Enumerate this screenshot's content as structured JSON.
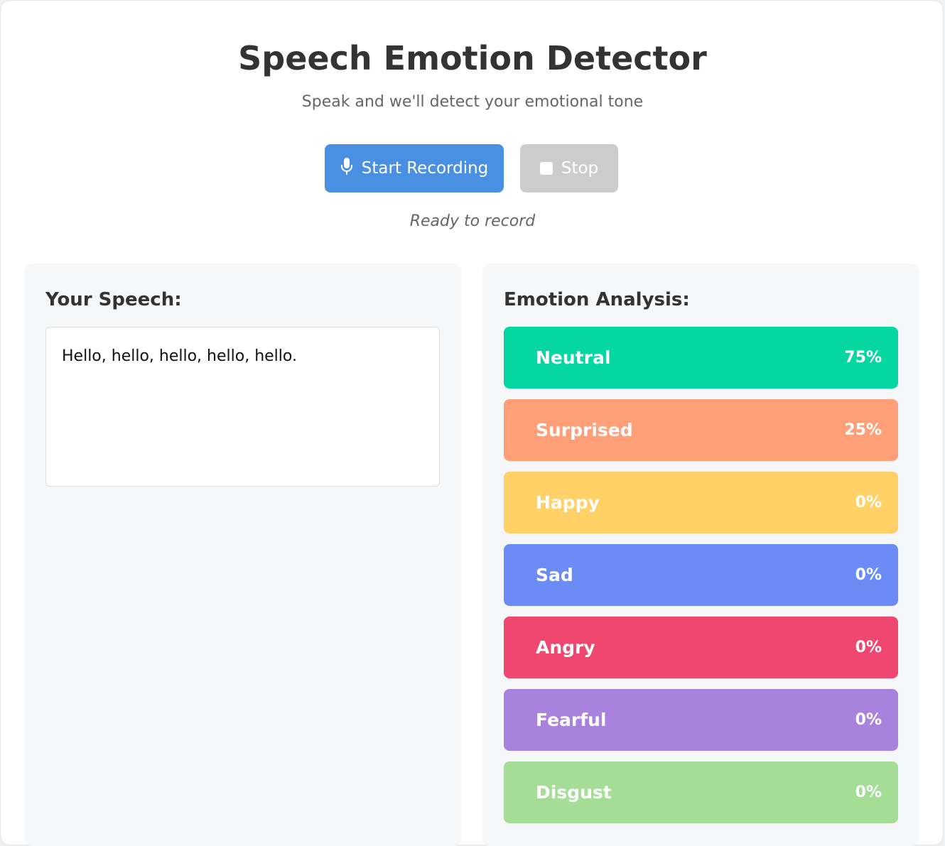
{
  "header": {
    "title": "Speech Emotion Detector",
    "subtitle": "Speak and we'll detect your emotional tone"
  },
  "controls": {
    "start_label": "Start Recording",
    "start_icon": "microphone-icon",
    "stop_label": "Stop",
    "stop_icon": "stop-square-icon",
    "start_color": "#4a90e2",
    "stop_color": "#cccccc"
  },
  "status": {
    "text": "Ready to record"
  },
  "speech": {
    "heading": "Your Speech:",
    "transcript": "Hello, hello, hello, hello, hello."
  },
  "analysis": {
    "heading": "Emotion Analysis:",
    "emotions": [
      {
        "name": "Neutral",
        "percent": "75%",
        "color": "#06d6a0"
      },
      {
        "name": "Surprised",
        "percent": "25%",
        "color": "#ff9f77"
      },
      {
        "name": "Happy",
        "percent": "0%",
        "color": "#ffd166"
      },
      {
        "name": "Sad",
        "percent": "0%",
        "color": "#6c8cf5"
      },
      {
        "name": "Angry",
        "percent": "0%",
        "color": "#ef476f"
      },
      {
        "name": "Fearful",
        "percent": "0%",
        "color": "#a882dd"
      },
      {
        "name": "Disgust",
        "percent": "0%",
        "color": "#a5dd97"
      }
    ]
  }
}
